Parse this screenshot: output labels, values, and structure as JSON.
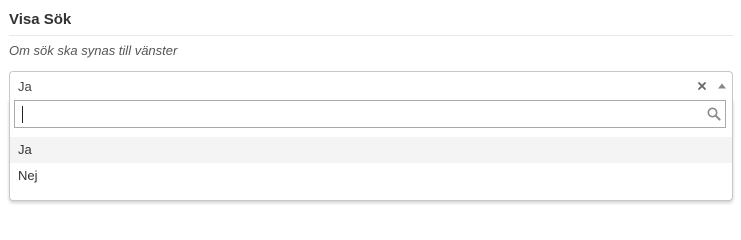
{
  "section": {
    "title": "Visa Sök",
    "description": "Om sök ska synas till vänster"
  },
  "select": {
    "selected_value": "Ja",
    "clear_icon": "close-icon",
    "toggle_icon": "triangle-up-icon",
    "search": {
      "value": "",
      "placeholder": "",
      "icon": "search-icon"
    },
    "options": [
      {
        "label": "Ja",
        "highlighted": true
      },
      {
        "label": "Nej",
        "highlighted": false
      }
    ]
  },
  "colors": {
    "border": "#c8c8c8",
    "highlight": "#f4f4f4",
    "text": "#333333"
  }
}
